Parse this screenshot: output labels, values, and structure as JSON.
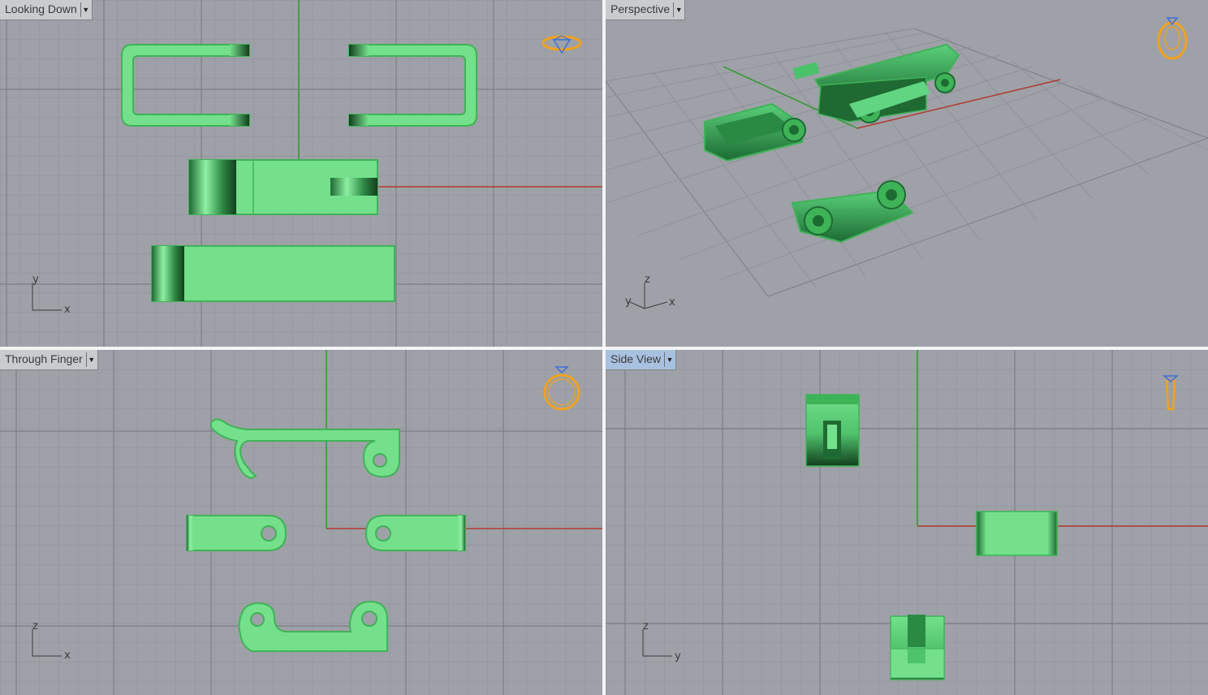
{
  "viewports": [
    {
      "id": "top",
      "title": "Looking Down",
      "active": false,
      "axis_labels": [
        "y",
        "x"
      ],
      "widget_icon": "diamond-top-icon"
    },
    {
      "id": "persp",
      "title": "Perspective",
      "active": false,
      "axis_labels": [
        "z",
        "y",
        "x"
      ],
      "widget_icon": "ring-perspective-icon"
    },
    {
      "id": "front",
      "title": "Through Finger",
      "active": false,
      "axis_labels": [
        "z",
        "x"
      ],
      "widget_icon": "ring-front-icon"
    },
    {
      "id": "side",
      "title": "Side View",
      "active": true,
      "axis_labels": [
        "z",
        "y"
      ],
      "widget_icon": "ring-side-icon"
    }
  ],
  "colors": {
    "viewport_bg": "#9ea1a7",
    "grid_minor": "#8f9298",
    "grid_major": "#7c7f85",
    "axis_x": "#b03a2e",
    "axis_y": "#2a9a2a",
    "object_fill": "#74e08c",
    "object_edge": "#3fb357",
    "object_dark": "#1f6a32",
    "widget": "#f0a21f",
    "widget_gem": "#3f6fd8"
  }
}
